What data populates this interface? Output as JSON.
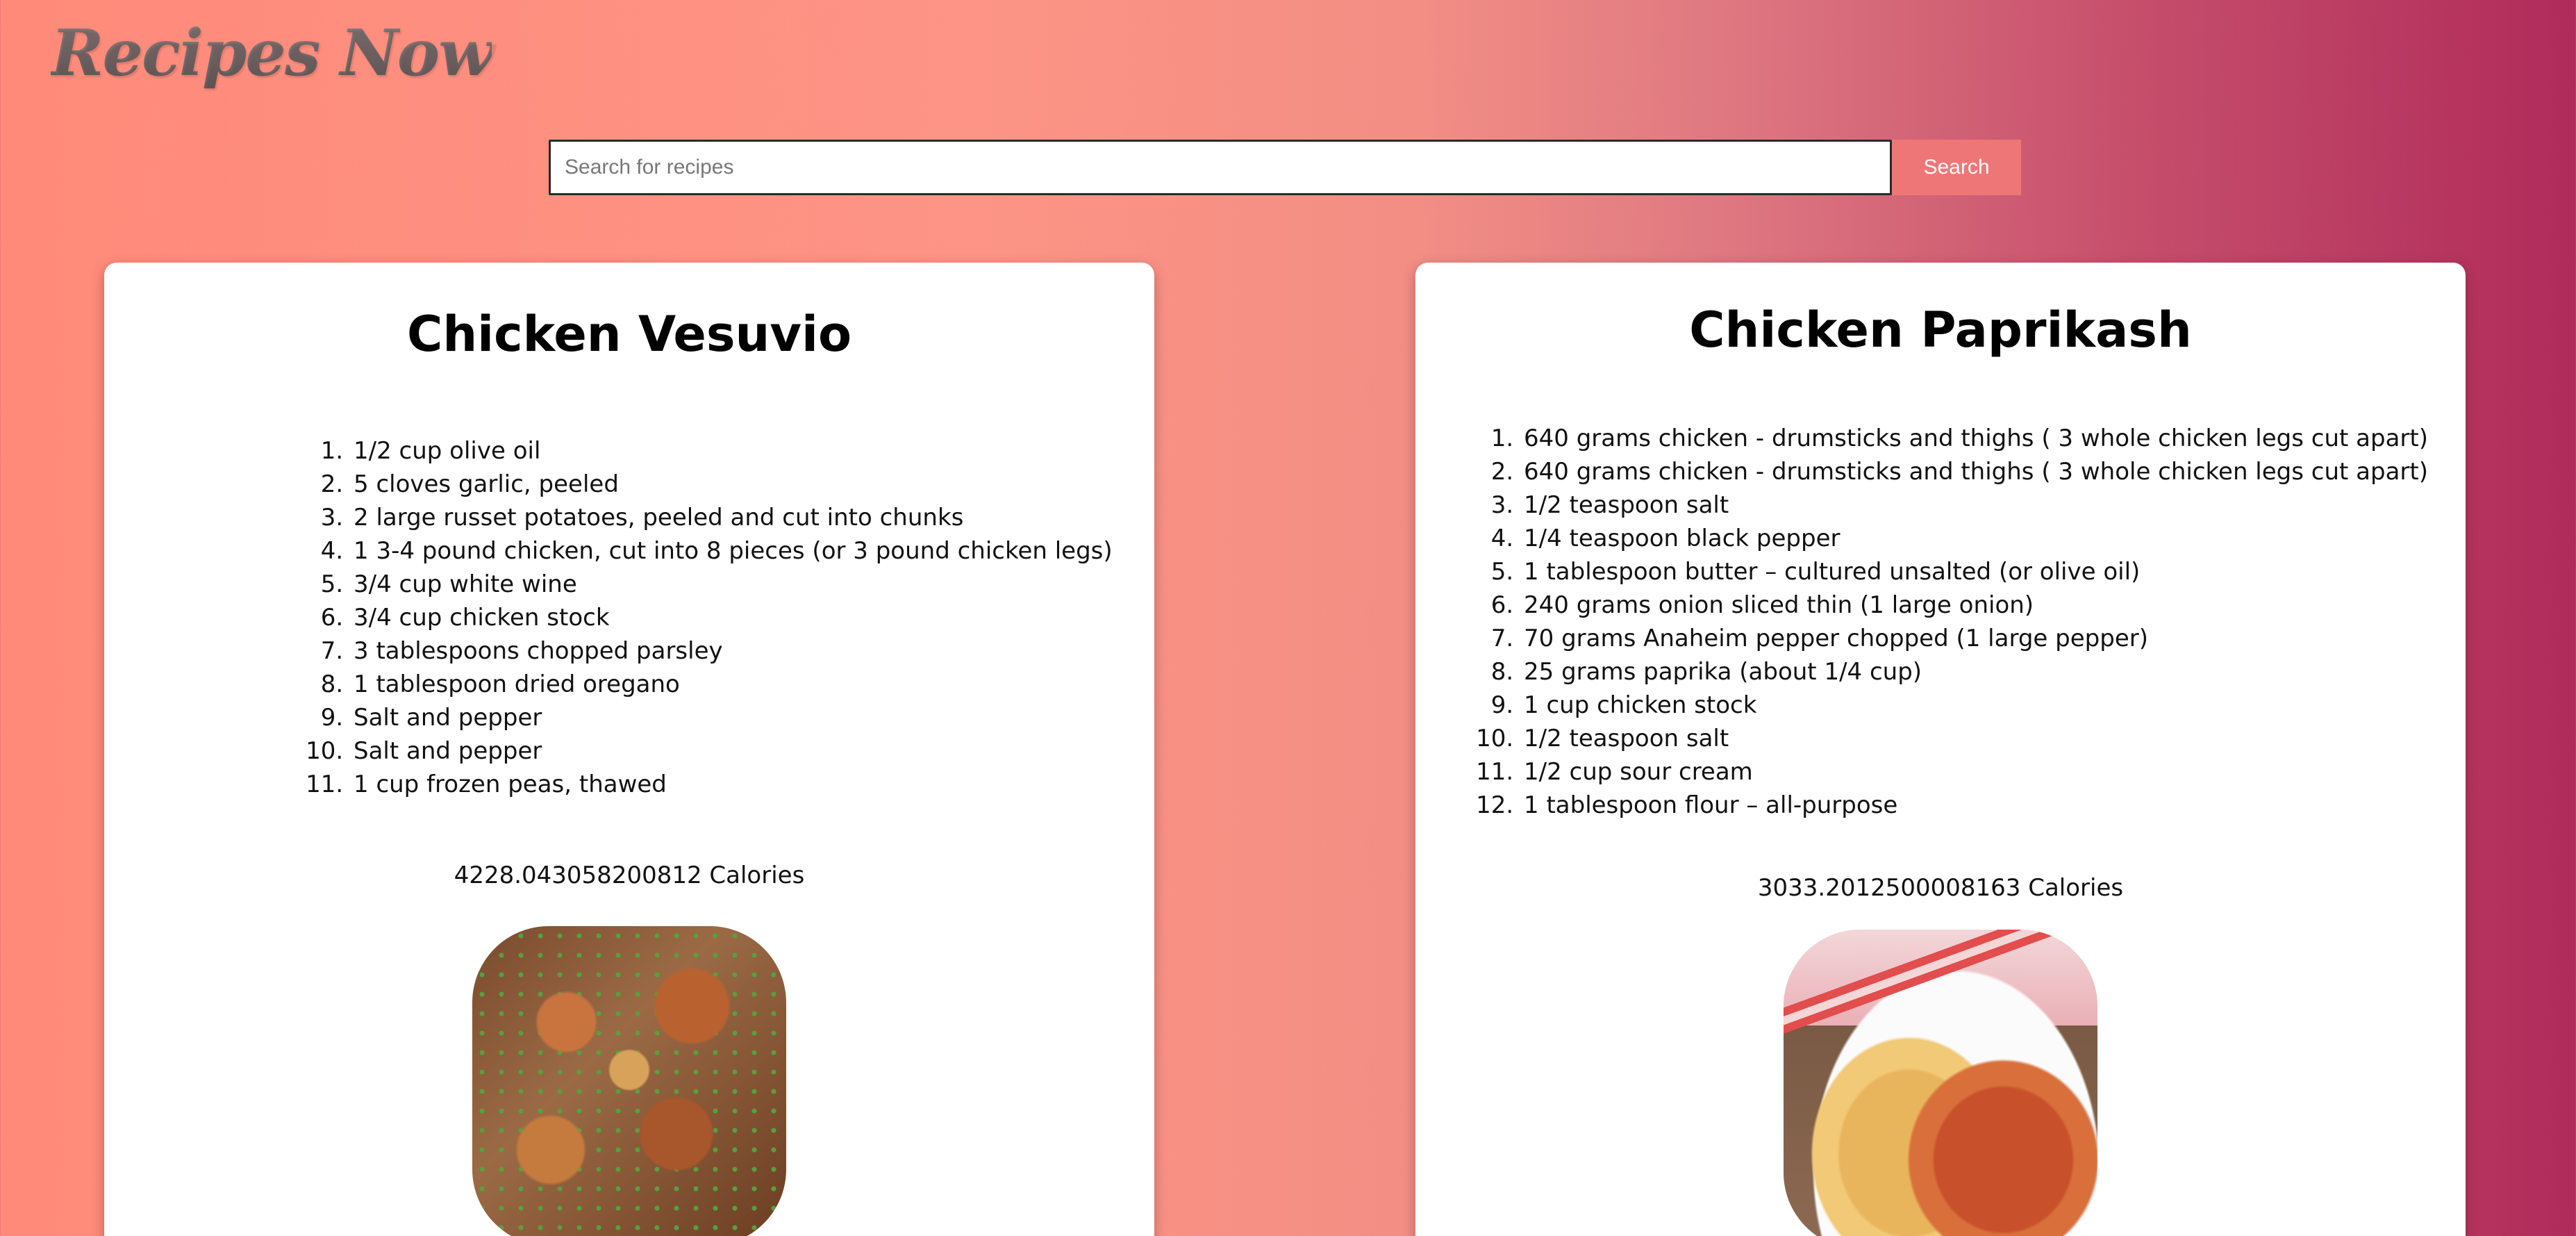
{
  "app": {
    "logo_text": "Recipes Now"
  },
  "search": {
    "placeholder": "Search for recipes",
    "value": "",
    "button_label": "Search"
  },
  "colors": {
    "search_button_bg": "#ef7677",
    "card_bg": "#ffffff"
  },
  "recipes": [
    {
      "title": "Chicken Vesuvio",
      "ingredients": [
        "1/2 cup olive oil",
        "5 cloves garlic, peeled",
        "2 large russet potatoes, peeled and cut into chunks",
        "1 3-4 pound chicken, cut into 8 pieces (or 3 pound chicken legs)",
        "3/4 cup white wine",
        "3/4 cup chicken stock",
        "3 tablespoons chopped parsley",
        "1 tablespoon dried oregano",
        "Salt and pepper",
        "Salt and pepper",
        "1 cup frozen peas, thawed"
      ],
      "calories": "4228.043058200812 Calories",
      "image_icon": "recipe-photo"
    },
    {
      "title": "Chicken Paprikash",
      "ingredients": [
        "640 grams chicken - drumsticks and thighs ( 3 whole chicken legs cut apart)",
        "640 grams chicken - drumsticks and thighs ( 3 whole chicken legs cut apart)",
        "1/2 teaspoon salt",
        "1/4 teaspoon black pepper",
        "1 tablespoon butter – cultured unsalted (or olive oil)",
        "240 grams onion sliced thin (1 large onion)",
        "70 grams Anaheim pepper chopped (1 large pepper)",
        "25 grams paprika (about 1/4 cup)",
        "1 cup chicken stock",
        "1/2 teaspoon salt",
        "1/2 cup sour cream",
        "1 tablespoon flour – all-purpose"
      ],
      "calories": "3033.2012500008163 Calories",
      "image_icon": "recipe-photo"
    }
  ]
}
